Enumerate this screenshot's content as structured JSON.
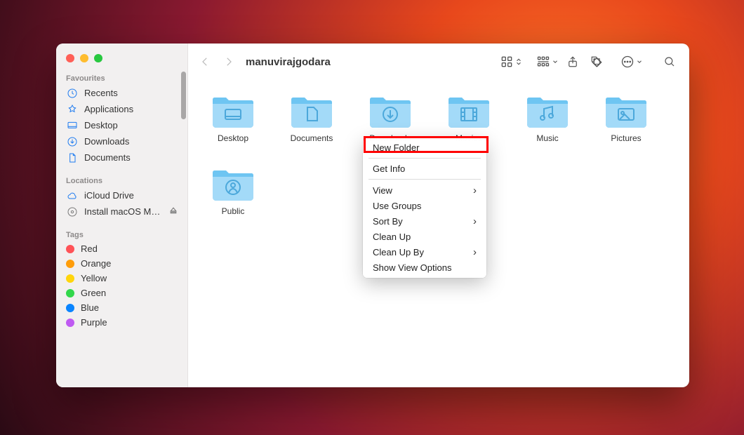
{
  "window_title": "manuvirajgodara",
  "traffic_lights": {
    "close": "close",
    "minimize": "minimize",
    "zoom": "zoom"
  },
  "sidebar": {
    "sections": [
      {
        "header": "Favourites",
        "items": [
          {
            "icon": "clock",
            "label": "Recents"
          },
          {
            "icon": "apps",
            "label": "Applications"
          },
          {
            "icon": "desktop",
            "label": "Desktop"
          },
          {
            "icon": "download",
            "label": "Downloads"
          },
          {
            "icon": "doc",
            "label": "Documents"
          }
        ]
      },
      {
        "header": "Locations",
        "items": [
          {
            "icon": "cloud",
            "label": "iCloud Drive"
          },
          {
            "icon": "disk",
            "label": "Install macOS Mon…",
            "eject": true,
            "muted": true
          }
        ]
      },
      {
        "header": "Tags",
        "items": [
          {
            "icon": "tag",
            "color": "#ff5257",
            "label": "Red"
          },
          {
            "icon": "tag",
            "color": "#ff9d0a",
            "label": "Orange"
          },
          {
            "icon": "tag",
            "color": "#ffd50c",
            "label": "Yellow"
          },
          {
            "icon": "tag",
            "color": "#32d74b",
            "label": "Green"
          },
          {
            "icon": "tag",
            "color": "#0a84ff",
            "label": "Blue"
          },
          {
            "icon": "tag",
            "color": "#bf5af2",
            "label": "Purple"
          }
        ]
      }
    ]
  },
  "toolbar": {
    "back": "back",
    "forward": "forward",
    "view_icons": "icon-view-toggle",
    "group_by": "group-by",
    "share": "share",
    "tags": "edit-tags",
    "more": "more-actions",
    "search": "search"
  },
  "folders": [
    {
      "name": "Desktop",
      "glyph": "desktop"
    },
    {
      "name": "Documents",
      "glyph": "doc"
    },
    {
      "name": "Downloads",
      "glyph": "download"
    },
    {
      "name": "Movies",
      "glyph": "movie"
    },
    {
      "name": "Music",
      "glyph": "music"
    },
    {
      "name": "Pictures",
      "glyph": "picture"
    },
    {
      "name": "Public",
      "glyph": "public"
    }
  ],
  "context_menu": {
    "highlighted_index": 0,
    "items": [
      {
        "label": "New Folder"
      },
      {
        "sep": true
      },
      {
        "label": "Get Info"
      },
      {
        "sep": true
      },
      {
        "label": "View",
        "submenu": true
      },
      {
        "label": "Use Groups"
      },
      {
        "label": "Sort By",
        "submenu": true
      },
      {
        "label": "Clean Up"
      },
      {
        "label": "Clean Up By",
        "submenu": true
      },
      {
        "label": "Show View Options"
      }
    ]
  },
  "colors": {
    "folder_light": "#a3daf8",
    "folder_dark": "#6ec5f2",
    "folder_mid": "#87d0f5"
  }
}
